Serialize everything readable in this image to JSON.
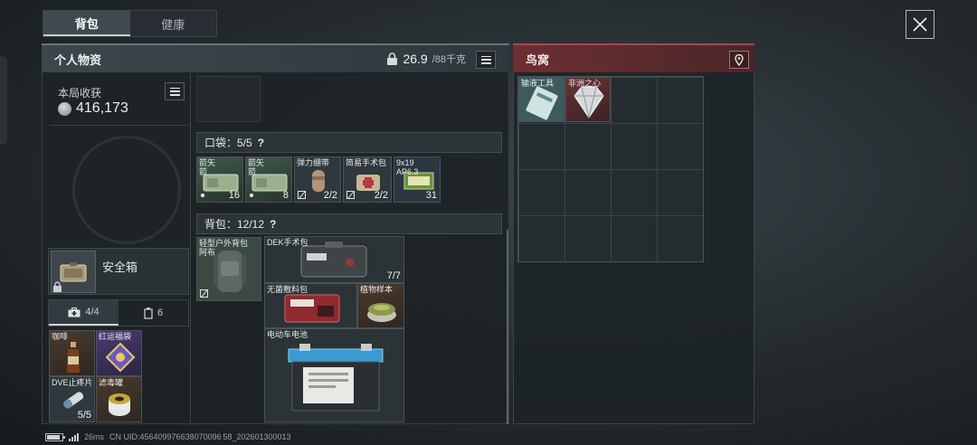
{
  "tabs": [
    {
      "label": "背包",
      "active": true
    },
    {
      "label": "健康",
      "active": false
    }
  ],
  "personal": {
    "title": "个人物资",
    "weight_value": "26.9",
    "weight_max": "/88千克",
    "harvest_label": "本局收获",
    "harvest_value": "416,173",
    "safebox_label": "安全箱",
    "subtab_1": "4/4",
    "subtab_2": "6",
    "safebox_items": [
      {
        "label": "咖啡",
        "count": ""
      },
      {
        "label": "红运福袋",
        "count": ""
      },
      {
        "label": "DVE止疼片",
        "count": "5/5"
      },
      {
        "label": "滤毒罐",
        "count": ""
      }
    ],
    "pocket_title": "口袋：5/5",
    "pocket_help": "?",
    "pocket_items": [
      {
        "label": "箭矢",
        "sub": "箭",
        "count": "16"
      },
      {
        "label": "箭矢",
        "sub": "箭",
        "count": "8"
      },
      {
        "label": "弹力绷带",
        "sub": "",
        "count": "2/2"
      },
      {
        "label": "简易手术包",
        "sub": "",
        "count": "2/2"
      },
      {
        "label": "9x19",
        "sub": "AP6.3",
        "count": "31"
      }
    ],
    "backpack_title": "背包：12/12",
    "backpack_help": "?",
    "backpack_equipped": {
      "label": "轻型户外背包",
      "sub": "阿布"
    },
    "backpack_items": [
      {
        "label": "DEK手术包",
        "count": "7/7"
      },
      {
        "label": "无菌敷料包",
        "count": ""
      },
      {
        "label": "植物样本",
        "count": ""
      },
      {
        "label": "电动车电池",
        "count": ""
      }
    ]
  },
  "nest": {
    "title": "鸟窝",
    "items": [
      {
        "label": "输液工具",
        "count": ""
      },
      {
        "label": "非洲之心",
        "count": ""
      }
    ]
  },
  "status": {
    "ping": "26ms",
    "uid": "CN UID:456409976638070096 58_202601300013"
  },
  "colors": {
    "accent_red": "#6d2f33",
    "panel": "#1d2326"
  }
}
